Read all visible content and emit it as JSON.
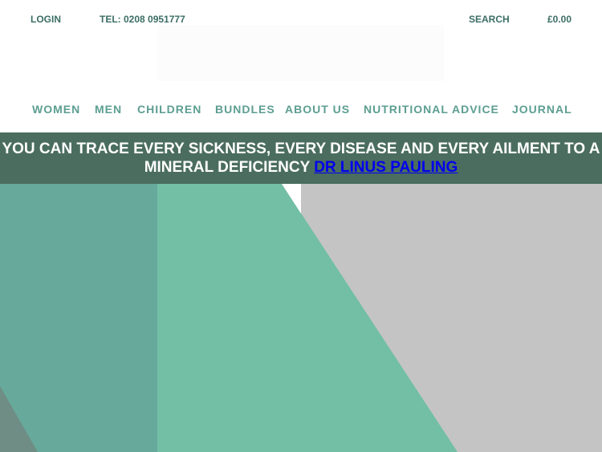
{
  "topbar": {
    "login_label": "LOGIN",
    "phone_label": "TEL: 0208 0951777",
    "search_label": "SEARCH",
    "cart_total": "£0.00"
  },
  "nav": {
    "women": "WOMEN",
    "men": "MEN",
    "children": "CHILDREN",
    "bundles": "BUNDLES",
    "about_us": "ABOUT US",
    "nutritional_advice": "NUTRITIONAL ADVICE",
    "journal": "JOURNAL"
  },
  "banner": {
    "quote": "YOU CAN TRACE EVERY SICKNESS, EVERY DISEASE AND EVERY AILMENT TO A MINERAL DEFICIENCY ",
    "author_link": "DR LINUS PAULING "
  },
  "colors": {
    "nav_text": "#5c9e91",
    "topbar_text": "#3b6e64",
    "banner_bg": "#4b6d60",
    "hero_teal": "#67a99b",
    "hero_mint": "#72bfa5",
    "hero_grey": "#c4c4c4"
  }
}
